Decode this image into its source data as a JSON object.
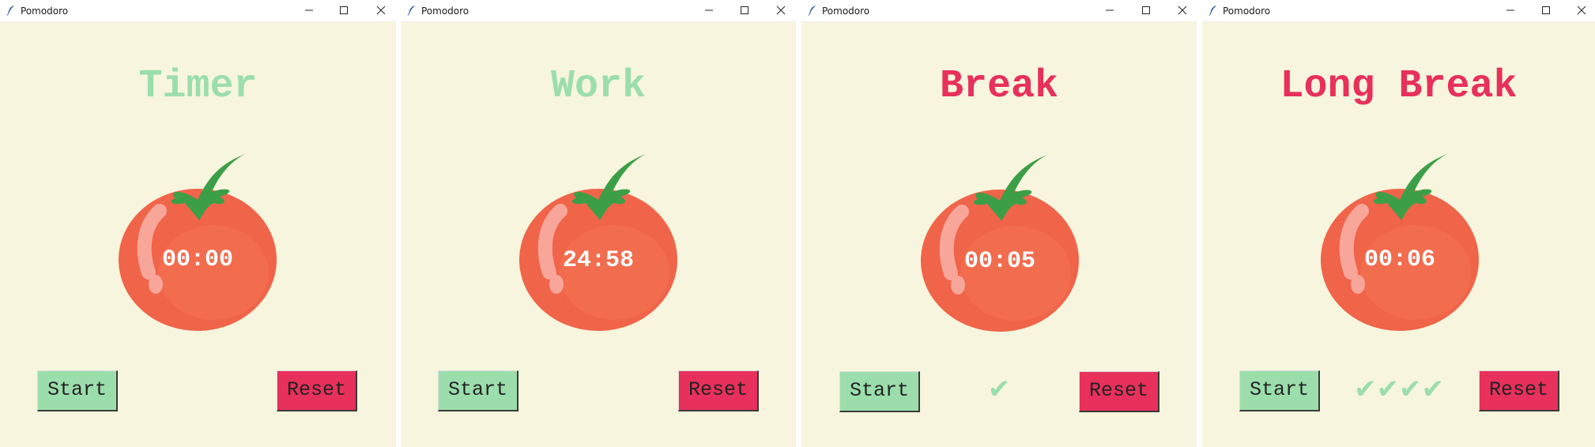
{
  "windows": [
    {
      "title": "Pomodoro",
      "label": "Timer",
      "label_color": "#9bdeac",
      "time": "00:00",
      "start_label": "Start",
      "reset_label": "Reset",
      "checks": ""
    },
    {
      "title": "Pomodoro",
      "label": "Work",
      "label_color": "#9bdeac",
      "time": "24:58",
      "start_label": "Start",
      "reset_label": "Reset",
      "checks": ""
    },
    {
      "title": "Pomodoro",
      "label": "Break",
      "label_color": "#e7305b",
      "time": "00:05",
      "start_label": "Start",
      "reset_label": "Reset",
      "checks": "✔"
    },
    {
      "title": "Pomodoro",
      "label": "Long Break",
      "label_color": "#e7305b",
      "time": "00:06",
      "start_label": "Start",
      "reset_label": "Reset",
      "checks": "✔✔✔✔"
    }
  ],
  "colors": {
    "background": "#f7f5dd",
    "green": "#9bdeac",
    "red": "#e7305b",
    "tomato": "#f06449",
    "leaf": "#3c9f47"
  },
  "icons": [
    "feather-icon",
    "minimize-icon",
    "maximize-icon",
    "close-icon",
    "tomato-icon",
    "checkmark-icon"
  ]
}
